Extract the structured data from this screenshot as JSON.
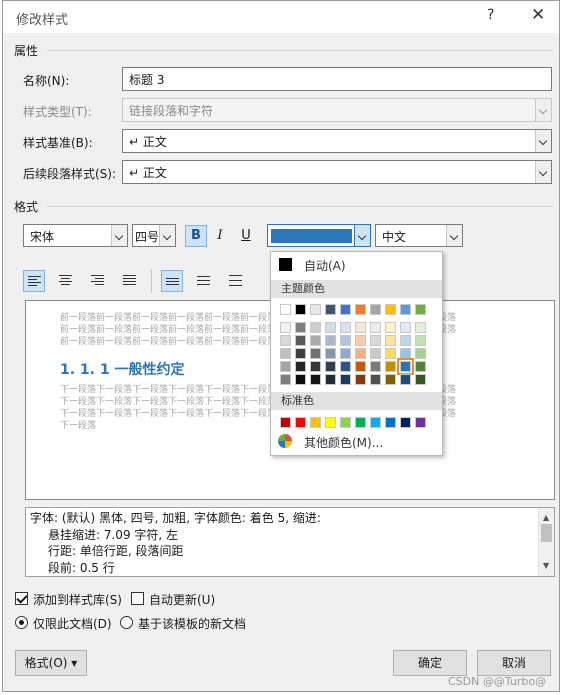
{
  "dialog": {
    "title": "修改样式",
    "help_glyph": "?",
    "close_glyph": "✕"
  },
  "properties": {
    "section": "属性",
    "name_label": "名称(N):",
    "name_value": "标题 3",
    "style_type_label": "样式类型(T):",
    "style_type_value": "链接段落和字符",
    "based_on_label": "样式基准(B):",
    "based_on_value": "↵ 正文",
    "following_label": "后续段落样式(S):",
    "following_value": "↵ 正文"
  },
  "format": {
    "section": "格式",
    "font": "宋体",
    "size": "四号",
    "bold": "B",
    "italic": "I",
    "underline": "U",
    "font_color": "#2e75b6",
    "script": "中文"
  },
  "preview": {
    "before_lines": [
      "前一段落前一段落前一段落前一段落前一段落前一段落前一段落前一段落前一段落前一段落前一段落",
      "前一段落前一段落前一段落前一段落前一段落前一段落前一段落前一段落前一段落前一段落前一段落",
      "前一段落前一段落前一段落前一段落前一段落前一段落前一段落前一段落前一段落"
    ],
    "heading": "1. 1. 1 一般性约定",
    "after_lines": [
      "下一段落下一段落下一段落下一段落下一段落下一段落下一段落下一段落下一段落下一段落下一段落",
      "下一段落下一段落下一段落下一段落下一段落下一段落下一段落下一段落下一段落下一段落下一段落",
      "下一段落下一段落下一段落下一段落下一段落下一段落下一段落下一段落下一段落下一段落下一段落",
      "下一段落"
    ]
  },
  "description": {
    "line1": "字体: (默认) 黑体, 四号, 加粗, 字体颜色: 着色 5, 缩进:",
    "line2": "悬挂缩进: 7.09 字符, 左",
    "line3": "行距: 单倍行距, 段落间距",
    "line4": "段前: 0.5 行"
  },
  "options": {
    "add_to_gallery": "添加到样式库(S)",
    "auto_update": "自动更新(U)",
    "only_this_doc": "仅限此文档(D)",
    "new_docs_template": "基于该模板的新文档"
  },
  "buttons": {
    "format": "格式(O) ▾",
    "ok": "确定",
    "cancel": "取消"
  },
  "color_popup": {
    "automatic": "自动(A)",
    "theme_colors_header": "主题颜色",
    "standard_colors_header": "标准色",
    "more_colors": "其他颜色(M)...",
    "theme_top_row": [
      "#ffffff",
      "#000000",
      "#e7e6e6",
      "#44546a",
      "#4472c4",
      "#ed7d31",
      "#a5a5a5",
      "#ffc000",
      "#5b9bd5",
      "#70ad47"
    ],
    "theme_shades": [
      [
        "#f2f2f2",
        "#7f7f7f",
        "#d0cece",
        "#d6dce4",
        "#d9e2f3",
        "#fbe5d5",
        "#ededed",
        "#fff2cc",
        "#deebf6",
        "#e2efd9"
      ],
      [
        "#d8d8d8",
        "#595959",
        "#aeabab",
        "#adb9ca",
        "#b4c6e7",
        "#f7cbac",
        "#dbdbdb",
        "#fee599",
        "#bdd7ee",
        "#c5e0b3"
      ],
      [
        "#bfbfbf",
        "#3f3f3f",
        "#757070",
        "#8496b0",
        "#8eaadb",
        "#f4b183",
        "#c9c9c9",
        "#ffd965",
        "#9cc3e5",
        "#a8d08d"
      ],
      [
        "#a5a5a5",
        "#262626",
        "#3a3838",
        "#323f4f",
        "#2f5496",
        "#c55a11",
        "#7b7b7b",
        "#bf9000",
        "#2e75b5",
        "#538135"
      ],
      [
        "#7f7f7f",
        "#0c0c0c",
        "#171616",
        "#222a35",
        "#1f3864",
        "#833c0b",
        "#525252",
        "#7f6000",
        "#1e4e79",
        "#375623"
      ]
    ],
    "standard": [
      "#c00000",
      "#ff0000",
      "#ffc000",
      "#ffff00",
      "#92d050",
      "#00b050",
      "#00b0f0",
      "#0070c0",
      "#002060",
      "#7030a0"
    ]
  },
  "watermark": "CSDN @@Turbo@"
}
